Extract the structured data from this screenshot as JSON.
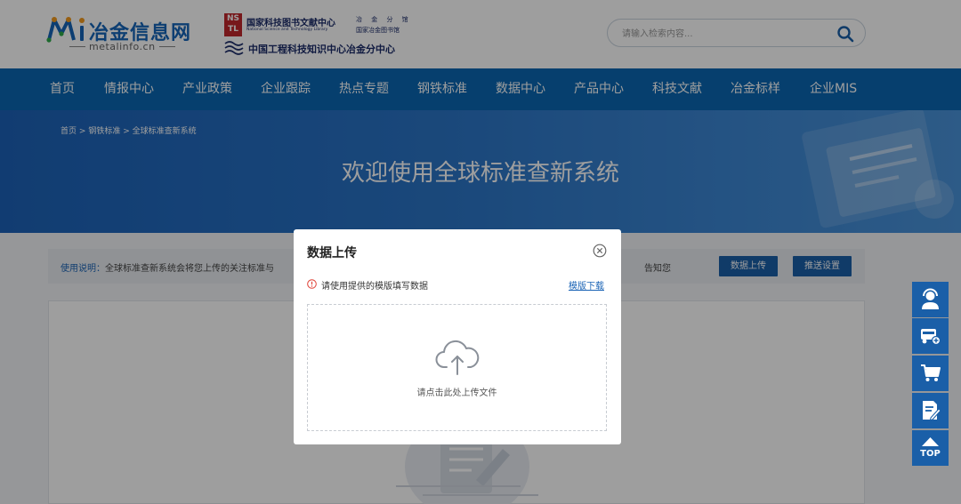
{
  "header": {
    "logo_title": "冶金信息网",
    "logo_sub": "metalinfo.cn",
    "nstl_box": "NS TL",
    "nstl_name": "国家科技图书文献中心",
    "nstl_en": "National Science and Technology Library",
    "nstl_right1": "冶 金 分 馆",
    "nstl_right2": "国家冶金图书馆",
    "nstl_line2": "中国工程科技知识中心冶金分中心",
    "search_placeholder": "请输入检索内容..."
  },
  "nav": [
    "首页",
    "情报中心",
    "产业政策",
    "企业跟踪",
    "热点专题",
    "钢铁标准",
    "数据中心",
    "产品中心",
    "科技文献",
    "冶金标样",
    "企业MIS"
  ],
  "breadcrumb": [
    "首页",
    ">",
    "钢铁标准",
    ">",
    "全球标准查新系统"
  ],
  "banner_title": "欢迎使用全球标准查新系统",
  "info": {
    "label": "使用说明：",
    "text": "全球标准查新系统会将您上传的关注标准与",
    "tail": "告知您",
    "upload_button": "数据上传",
    "push_button": "推送设置"
  },
  "side_tools": {
    "top_label": "TOP"
  },
  "modal": {
    "title": "数据上传",
    "warning": "请使用提供的模版填写数据",
    "template_link": "模版下载",
    "upload_text": "请点击此处上传文件"
  },
  "colors": {
    "brand_blue": "#0b67b2",
    "button_blue": "#1a5fa8",
    "link_blue": "#1a63b5",
    "warning_red": "#e0453a"
  }
}
